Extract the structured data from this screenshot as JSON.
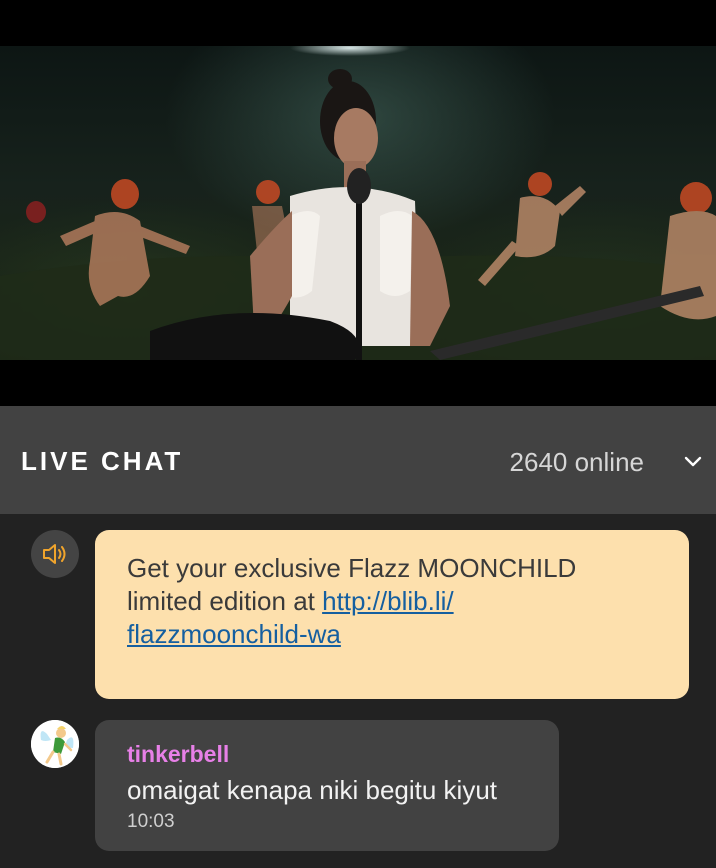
{
  "video": {
    "description_icon": "video-frame-icon"
  },
  "live_chat": {
    "title": "LIVE CHAT",
    "online": "2640 online",
    "toggle_icon": "chevron-down-icon"
  },
  "promo": {
    "icon": "speaker-icon",
    "text_prefix": "Get your exclusive Flazz MOONCHILD limited edition at ",
    "link_text": "http://blib.li/flazzmoonchild-wa",
    "link_line1": "http://blib.li/",
    "link_line2": "flazzmoonchild-wa"
  },
  "messages": [
    {
      "username": "tinkerbell",
      "text": "omaigat kenapa niki begitu kiyut",
      "time": "10:03",
      "avatar_icon": "fairy-avatar-icon"
    }
  ],
  "colors": {
    "header_bg": "#424242",
    "chat_bg": "#222222",
    "promo_bg": "#fde0ad",
    "username": "#e880e8",
    "link": "#155fa0"
  }
}
